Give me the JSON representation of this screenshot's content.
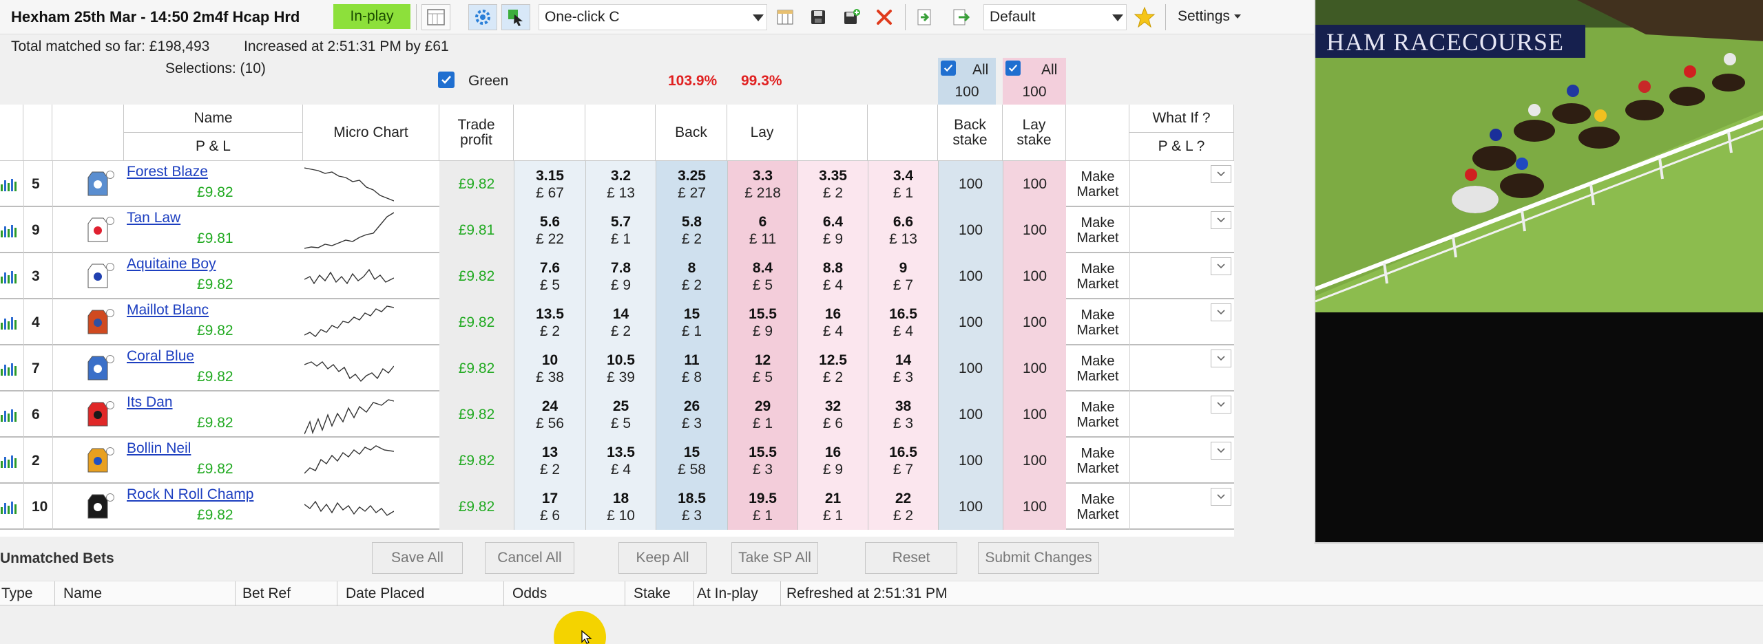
{
  "toolbar": {
    "event_title": "Hexham 25th Mar - 14:50 2m4f Hcap Hrd",
    "inplay_badge": "In-play",
    "oneclick_value": "One-click C",
    "layout_value": "Default",
    "settings_label": "Settings"
  },
  "info": {
    "total_matched": "Total matched so far: £198,493",
    "increased": "Increased at 2:51:31 PM by £61",
    "selections": "Selections: (10)",
    "green_label": "Green",
    "book_back": "103.9%",
    "book_lay": "99.3%",
    "all_back_label": "All",
    "all_back_value": "100",
    "all_lay_label": "All",
    "all_lay_value": "100"
  },
  "columns": {
    "name": "Name",
    "pl": "P & L",
    "micro_chart": "Micro Chart",
    "trade_profit": "Trade profit",
    "back": "Back",
    "lay": "Lay",
    "back_stake": "Back stake",
    "lay_stake": "Lay stake",
    "what_if": "What If ?",
    "pl_q": "P & L ?"
  },
  "runners": [
    {
      "num": "5",
      "name": "Forest Blaze",
      "pl": "£9.82",
      "trade": "£9.82",
      "prices": [
        [
          "3.15",
          "£ 67"
        ],
        [
          "3.2",
          "£ 13"
        ],
        [
          "3.25",
          "£ 27"
        ],
        [
          "3.3",
          "£ 218"
        ],
        [
          "3.35",
          "£ 2"
        ],
        [
          "3.4",
          "£ 1"
        ]
      ],
      "back_stake": "100",
      "lay_stake": "100",
      "action": "Make Market",
      "silk": "#5a8ed0",
      "silk_accent": "#ffffff"
    },
    {
      "num": "9",
      "name": "Tan Law",
      "pl": "£9.81",
      "trade": "£9.81",
      "prices": [
        [
          "5.6",
          "£ 22"
        ],
        [
          "5.7",
          "£ 1"
        ],
        [
          "5.8",
          "£ 2"
        ],
        [
          "6",
          "£ 11"
        ],
        [
          "6.4",
          "£ 9"
        ],
        [
          "6.6",
          "£ 13"
        ]
      ],
      "back_stake": "100",
      "lay_stake": "100",
      "action": "Make Market",
      "silk": "#ffffff",
      "silk_accent": "#e02030"
    },
    {
      "num": "3",
      "name": "Aquitaine Boy",
      "pl": "£9.82",
      "trade": "£9.82",
      "prices": [
        [
          "7.6",
          "£ 5"
        ],
        [
          "7.8",
          "£ 9"
        ],
        [
          "8",
          "£ 2"
        ],
        [
          "8.4",
          "£ 5"
        ],
        [
          "8.8",
          "£ 4"
        ],
        [
          "9",
          "£ 7"
        ]
      ],
      "back_stake": "100",
      "lay_stake": "100",
      "action": "Make Market",
      "silk": "#ffffff",
      "silk_accent": "#2040b0"
    },
    {
      "num": "4",
      "name": "Maillot Blanc",
      "pl": "£9.82",
      "trade": "£9.82",
      "prices": [
        [
          "13.5",
          "£ 2"
        ],
        [
          "14",
          "£ 2"
        ],
        [
          "15",
          "£ 1"
        ],
        [
          "15.5",
          "£ 9"
        ],
        [
          "16",
          "£ 4"
        ],
        [
          "16.5",
          "£ 4"
        ]
      ],
      "back_stake": "100",
      "lay_stake": "100",
      "action": "Make Market",
      "silk": "#d04a20",
      "silk_accent": "#3050a0"
    },
    {
      "num": "7",
      "name": "Coral Blue",
      "pl": "£9.82",
      "trade": "£9.82",
      "prices": [
        [
          "10",
          "£ 38"
        ],
        [
          "10.5",
          "£ 39"
        ],
        [
          "11",
          "£ 8"
        ],
        [
          "12",
          "£ 5"
        ],
        [
          "12.5",
          "£ 2"
        ],
        [
          "14",
          "£ 3"
        ]
      ],
      "back_stake": "100",
      "lay_stake": "100",
      "action": "Make Market",
      "silk": "#3a6fc8",
      "silk_accent": "#ffffff"
    },
    {
      "num": "6",
      "name": "Its Dan",
      "pl": "£9.82",
      "trade": "£9.82",
      "prices": [
        [
          "24",
          "£ 56"
        ],
        [
          "25",
          "£ 5"
        ],
        [
          "26",
          "£ 3"
        ],
        [
          "29",
          "£ 1"
        ],
        [
          "32",
          "£ 6"
        ],
        [
          "38",
          "£ 3"
        ]
      ],
      "back_stake": "100",
      "lay_stake": "100",
      "action": "Make Market",
      "silk": "#e02828",
      "silk_accent": "#1a1a1a"
    },
    {
      "num": "2",
      "name": "Bollin Neil",
      "pl": "£9.82",
      "trade": "£9.82",
      "prices": [
        [
          "13",
          "£ 2"
        ],
        [
          "13.5",
          "£ 4"
        ],
        [
          "15",
          "£ 58"
        ],
        [
          "15.5",
          "£ 3"
        ],
        [
          "16",
          "£ 9"
        ],
        [
          "16.5",
          "£ 7"
        ]
      ],
      "back_stake": "100",
      "lay_stake": "100",
      "action": "Make Market",
      "silk": "#e8a020",
      "silk_accent": "#2050c0"
    },
    {
      "num": "10",
      "name": "Rock N Roll Champ",
      "pl": "£9.82",
      "trade": "£9.82",
      "prices": [
        [
          "17",
          "£ 6"
        ],
        [
          "18",
          "£ 10"
        ],
        [
          "18.5",
          "£ 3"
        ],
        [
          "19.5",
          "£ 1"
        ],
        [
          "21",
          "£ 1"
        ],
        [
          "22",
          "£ 2"
        ]
      ],
      "back_stake": "100",
      "lay_stake": "100",
      "action": "Make Market",
      "silk": "#1a1a1a",
      "silk_accent": "#ffffff"
    }
  ],
  "actions": {
    "unmatched_title": "Unmatched Bets",
    "save_all": "Save All",
    "cancel_all": "Cancel All",
    "keep_all": "Keep All",
    "take_sp_all": "Take SP All",
    "reset": "Reset",
    "submit_changes": "Submit Changes"
  },
  "unmatched_columns": {
    "type": "Type",
    "name": "Name",
    "bet_ref": "Bet Ref",
    "date_placed": "Date Placed",
    "odds": "Odds",
    "stake": "Stake",
    "at_inplay": "At In-play",
    "refreshed": "Refreshed at 2:51:31 PM"
  },
  "video": {
    "sign_text": "HAM RACECOURSE"
  },
  "colors": {
    "inplay": "#8de03b",
    "back": "#cfe0ee",
    "lay": "#f3cdda",
    "profit_green": "#22aa22",
    "book_red": "#e02020",
    "link_blue": "#1d3fc0"
  },
  "icons": [
    "grid-icon",
    "gear-icon",
    "cursor-select-icon",
    "columns-icon",
    "save-icon",
    "add-save-icon",
    "delete-x-icon",
    "import-icon",
    "export-icon",
    "star-icon",
    "checkbox-icon",
    "bars-chart-icon",
    "silk-icon",
    "chevron-down-icon"
  ]
}
